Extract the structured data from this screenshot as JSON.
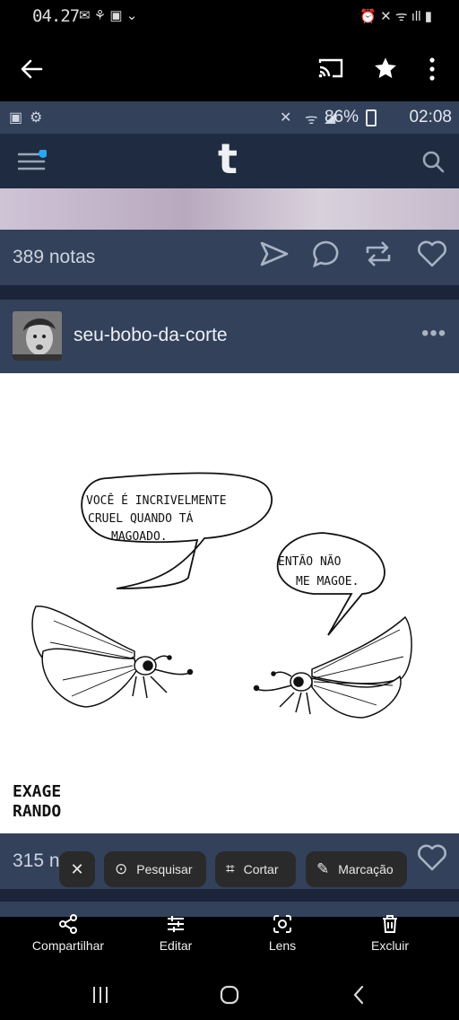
{
  "outer_status": {
    "time": "04.27",
    "icons_left": "✉ ⚘ ▣ ⌄",
    "icons_right": "⏰ ✕ ᯤ ıll ▮"
  },
  "viewer": {
    "back_icon": "arrow-left-icon",
    "cast_icon": "cast-icon",
    "star_icon": "star-icon",
    "more_icon": "more-vertical-icon"
  },
  "inner_status": {
    "battery": "86%",
    "time": "02:08"
  },
  "tumblr": {
    "logo": "t"
  },
  "post1": {
    "notes": "389 notas"
  },
  "post2": {
    "blog_name": "seu-bobo-da-corte",
    "more": "•••",
    "comic": {
      "bubble_left": [
        "VOCÊ  É  INCRIVELMENTE",
        "CRUEL  QUANDO  TÁ",
        "MAGOADO."
      ],
      "bubble_right": [
        "ENTÃO  NÃO",
        "ME  MAGOE."
      ],
      "signature": [
        "EXAGE",
        "RANDO"
      ]
    },
    "notes": "315 n"
  },
  "lens_chips": {
    "close": "✕",
    "search": "Pesquisar",
    "crop": "Cortar",
    "markup": "Marcação"
  },
  "toolbar": {
    "share": "Compartilhar",
    "edit": "Editar",
    "lens": "Lens",
    "delete": "Excluir"
  }
}
